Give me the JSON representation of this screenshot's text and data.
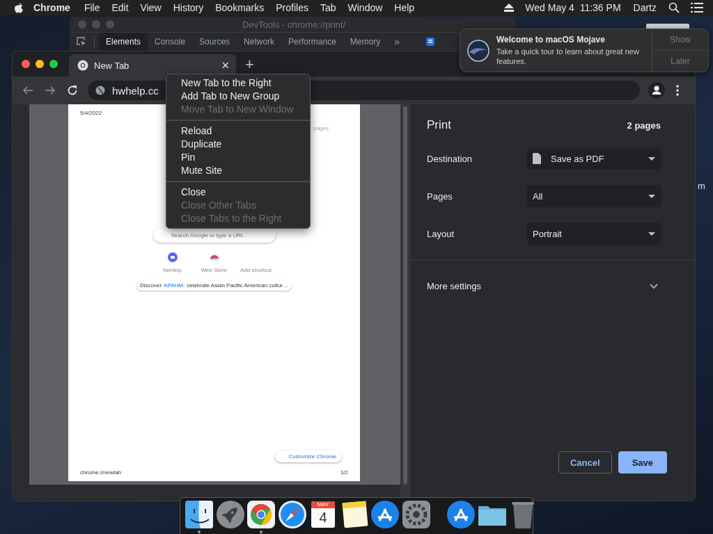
{
  "menu_bar": {
    "app": "Chrome",
    "items": [
      "File",
      "Edit",
      "View",
      "History",
      "Bookmarks",
      "Profiles",
      "Tab",
      "Window",
      "Help"
    ],
    "clock": "Wed May 4  11:36 PM",
    "user": "Dartz"
  },
  "devtools": {
    "title": "DevTools - chrome://print/",
    "overflow": "»",
    "tabs": [
      {
        "label": "Elements",
        "selected": true
      },
      {
        "label": "Console",
        "selected": false
      },
      {
        "label": "Sources",
        "selected": false
      },
      {
        "label": "Network",
        "selected": false
      },
      {
        "label": "Performance",
        "selected": false
      },
      {
        "label": "Memory",
        "selected": false
      }
    ]
  },
  "browser": {
    "tab_title": "New Tab",
    "tab_close": "×",
    "new_tab": "+",
    "address": "hwhelp.cc"
  },
  "preview": {
    "date": "5/4/2022",
    "header_fragment": "pages",
    "search_placeholder": "Search Google or type a URL",
    "shortcuts": [
      {
        "label": "hwHelp",
        "kind": "site"
      },
      {
        "label": "Web Store",
        "kind": "store"
      },
      {
        "label": "Add shortcut",
        "kind": "add"
      }
    ],
    "promo": {
      "prefix": "Discover",
      "link": "APAHM:",
      "suffix": "celebrate Asian Pacific American cultur…"
    },
    "customize": "Customize Chrome",
    "footer_url": "chrome://newtab",
    "page_number": "1/2"
  },
  "context_menu": {
    "groups": [
      [
        {
          "label": "New Tab to the Right",
          "disabled": false
        },
        {
          "label": "Add Tab to New Group",
          "disabled": false
        },
        {
          "label": "Move Tab to New Window",
          "disabled": true
        }
      ],
      [
        {
          "label": "Reload",
          "disabled": false
        },
        {
          "label": "Duplicate",
          "disabled": false
        },
        {
          "label": "Pin",
          "disabled": false
        },
        {
          "label": "Mute Site",
          "disabled": false
        }
      ],
      [
        {
          "label": "Close",
          "disabled": false
        },
        {
          "label": "Close Other Tabs",
          "disabled": true
        },
        {
          "label": "Close Tabs to the Right",
          "disabled": true
        }
      ]
    ]
  },
  "print": {
    "title": "Print",
    "page_count": "2 pages",
    "settings": [
      {
        "label": "Destination",
        "value": "Save as PDF",
        "kind": "file"
      },
      {
        "label": "Pages",
        "value": "All",
        "kind": "plain"
      },
      {
        "label": "Layout",
        "value": "Portrait",
        "kind": "plain"
      }
    ],
    "more_settings": {
      "label": "More settings",
      "expanded": false
    },
    "buttons": [
      {
        "label": "Cancel",
        "kind": "secondary"
      },
      {
        "label": "Save",
        "kind": "primary"
      }
    ]
  },
  "notification": {
    "title": "Welcome to macOS Mojave",
    "body": "Take a quick tour to learn about great new features.",
    "actions": [
      "Show",
      "Later"
    ]
  },
  "desktop": {
    "label_fragment": "m"
  },
  "dock": {
    "apps": [
      {
        "kind": "finder",
        "running": true
      },
      {
        "kind": "launchpad",
        "running": false
      },
      {
        "kind": "chrome",
        "running": true
      },
      {
        "kind": "safari",
        "running": false
      },
      {
        "kind": "calendar",
        "running": false,
        "month": "MAY",
        "day": "4"
      },
      {
        "kind": "notes",
        "running": false
      },
      {
        "kind": "appstore",
        "running": false
      },
      {
        "kind": "settings",
        "running": false
      },
      {
        "kind": "separator"
      },
      {
        "kind": "appstore",
        "running": false
      },
      {
        "kind": "folder",
        "running": false
      },
      {
        "kind": "trash",
        "running": false
      }
    ]
  }
}
